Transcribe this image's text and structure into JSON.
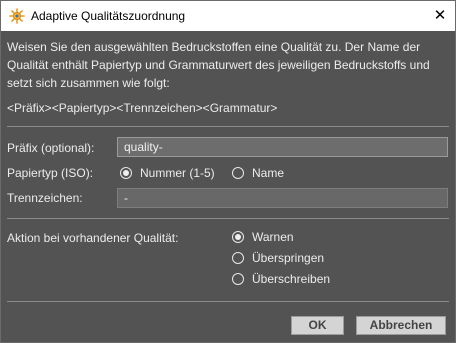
{
  "window": {
    "title": "Adaptive Qualitätszuordnung",
    "app_icon": "sun-gear-icon",
    "close_icon": "close-icon"
  },
  "description": "Weisen Sie den ausgewählten Bedruckstoffen eine Qualität zu. Der Name der Qualität enthält Papiertyp und Grammaturwert des jeweiligen Bedruckstoffs und setzt sich zusammen wie folgt:",
  "pattern": "<Präfix><Papiertyp><Trennzeichen><Grammatur>",
  "form": {
    "prefix_label": "Präfix (optional):",
    "prefix_value": "quality-",
    "papertype_label": "Papiertyp (ISO):",
    "papertype_options": [
      {
        "label": "Nummer (1-5)",
        "selected": true
      },
      {
        "label": "Name",
        "selected": false
      }
    ],
    "separator_label": "Trennzeichen:",
    "separator_value": "-"
  },
  "action": {
    "label": "Aktion bei vorhandener Qualität:",
    "options": [
      {
        "label": "Warnen",
        "selected": true
      },
      {
        "label": "Überspringen",
        "selected": false
      },
      {
        "label": "Überschreiben",
        "selected": false
      }
    ]
  },
  "buttons": {
    "ok": "OK",
    "cancel": "Abbrechen"
  },
  "colors": {
    "titlebar": "#ffffff",
    "dialog_bg": "#535353",
    "button_bg": "#d4d4d4",
    "field_bg": "#686868"
  }
}
